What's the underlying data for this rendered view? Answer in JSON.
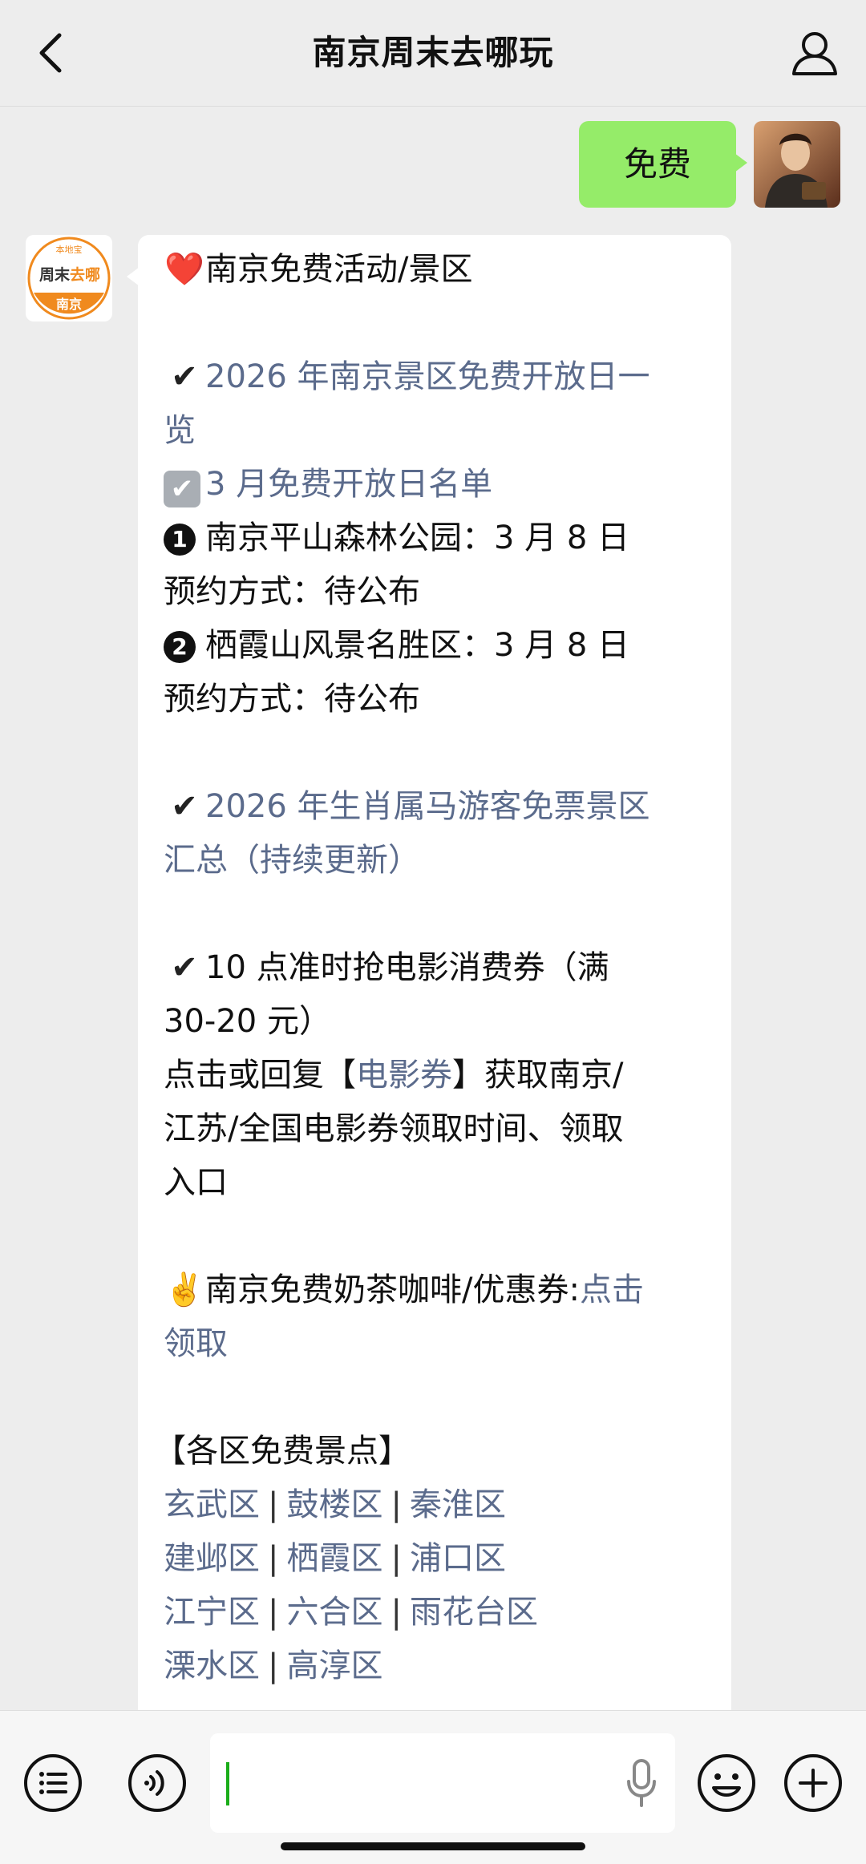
{
  "header": {
    "title": "南京周末去哪玩"
  },
  "chat": {
    "my_message": "免费",
    "bot_avatar": {
      "top_text": "本地宝",
      "brand_a": "周末",
      "brand_b": "去哪",
      "city": "南京"
    },
    "reply": {
      "section1_heart": "❤️",
      "section1_title": "南京免费活动/景区",
      "check_mark": "✔",
      "link1_line1": "2026 年南京景区免费开放日一",
      "link1_line2": "览",
      "link2": "3 月免费开放日名单",
      "item1_num": "1",
      "item1_text": "南京平山森林公园：3 月 8 日",
      "item1_method": "预约方式：待公布",
      "item2_num": "2",
      "item2_text": "栖霞山风景名胜区：3 月 8 日",
      "item2_method": "预约方式：待公布",
      "link3_line1": "2026 年生肖属马游客免票景区",
      "link3_line2": "汇总（持续更新）",
      "movie_line1": "10 点准时抢电影消费券（满",
      "movie_line2": "30-20 元）",
      "movie_pre": "点击或回复【",
      "movie_link": "电影券",
      "movie_post": "】获取南京/",
      "movie_line4": "江苏/全国电影券领取时间、领取",
      "movie_line5": "入口",
      "victory": "✌️",
      "coffee_text": "南京免费奶茶咖啡/优惠券:",
      "coffee_link1": "点击",
      "coffee_link2": "领取",
      "districts_title": "【各区免费景点】",
      "sep": "|",
      "districts": [
        [
          "玄武区",
          "鼓楼区",
          "秦淮区"
        ],
        [
          "建邺区",
          "栖霞区",
          "浦口区"
        ],
        [
          "江宁区",
          "六合区",
          "雨花台区"
        ],
        [
          "溧水区",
          "高淳区"
        ]
      ]
    }
  },
  "colors": {
    "link": "#5b6b8c",
    "my_bubble": "#95ec69",
    "bg": "#ededed"
  },
  "icons": [
    "back-chevron-icon",
    "user-icon",
    "list-icon",
    "voice-icon",
    "mic-icon",
    "emoji-icon",
    "plus-icon"
  ]
}
